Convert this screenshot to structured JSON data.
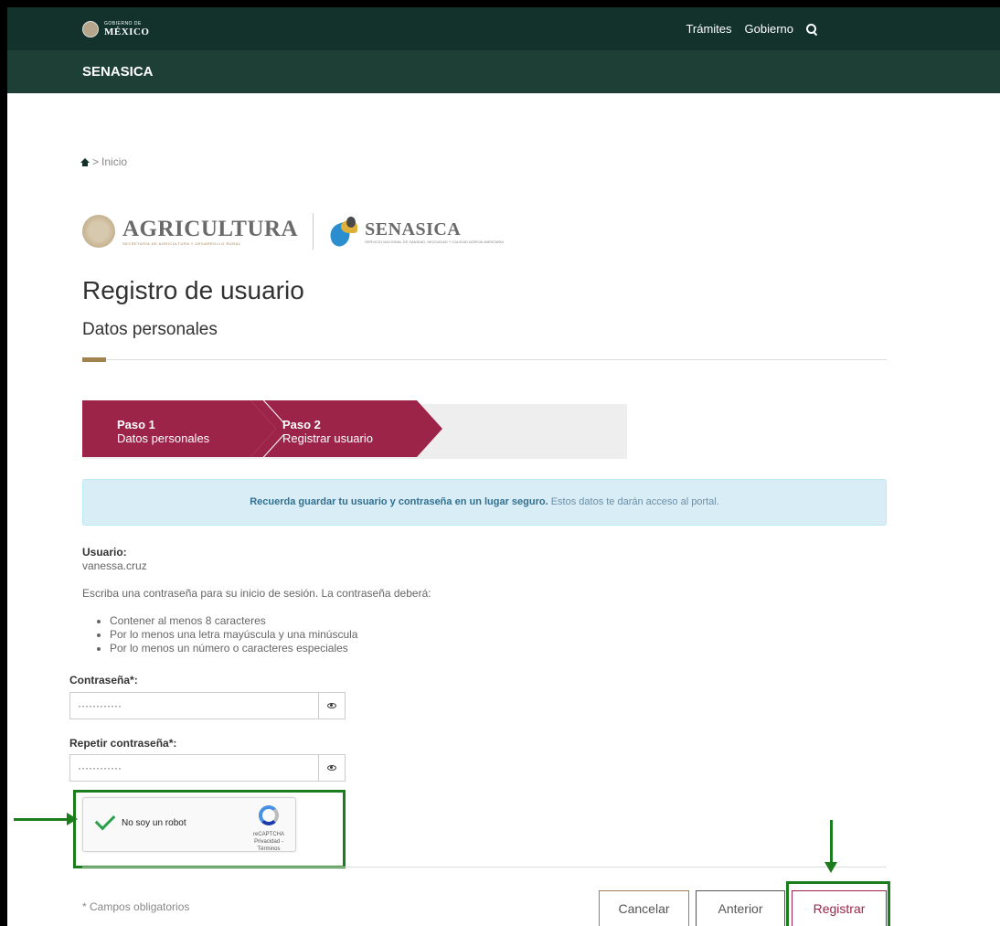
{
  "header": {
    "logo_small": "GOBIERNO DE",
    "logo_big": "MÉXICO",
    "nav": [
      "Trámites",
      "Gobierno"
    ],
    "icons": {
      "search": "search-icon"
    }
  },
  "subheader": {
    "title": "SENASICA"
  },
  "breadcrumb": {
    "home_icon": "home-icon",
    "sep": ">",
    "label": "Inicio"
  },
  "logos": {
    "agri_name": "AGRICULTURA",
    "agri_sub": "SECRETARÍA DE AGRICULTURA Y DESARROLLO RURAL",
    "sena_name": "SENASICA",
    "sena_sub": "SERVICIO NACIONAL DE SANIDAD, INOCUIDAD Y CALIDAD AGROALIMENTARIA"
  },
  "page": {
    "title": "Registro de usuario",
    "subtitle": "Datos personales"
  },
  "steps": [
    {
      "num": "Paso 1",
      "label": "Datos personales"
    },
    {
      "num": "Paso 2",
      "label": "Registrar usuario"
    }
  ],
  "alert": {
    "bold": "Recuerda guardar tu usuario y contraseña en un lugar seguro.",
    "rest": " Estos datos te darán acceso al portal."
  },
  "user": {
    "label": "Usuario:",
    "value": "vanessa.cruz"
  },
  "instructions": "Escriba una contraseña para su inicio de sesión. La contraseña deberá:",
  "requirements": [
    "Contener al menos 8 caracteres",
    "Por lo menos una letra mayúscula y una minúscula",
    "Por lo menos un número o caracteres especiales"
  ],
  "password": {
    "label": "Contraseña*:",
    "value": "············"
  },
  "password_repeat": {
    "label": "Repetir contraseña*:",
    "value": "············"
  },
  "captcha": {
    "label": "No soy un robot",
    "brand": "reCAPTCHA",
    "links": "Privacidad - Términos"
  },
  "footer": {
    "required_note": "* Campos obligatorios",
    "cancel": "Cancelar",
    "previous": "Anterior",
    "register": "Registrar"
  },
  "colors": {
    "header": "#13322b",
    "accent": "#9d2449",
    "gold": "#a0824f",
    "annotation": "#1b7d1b"
  }
}
